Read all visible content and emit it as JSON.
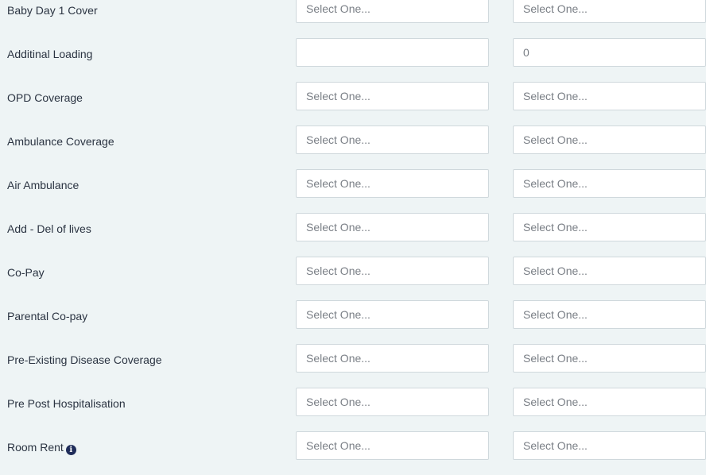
{
  "rows": [
    {
      "label": "Baby Day 1 Cover",
      "col1": "Select One...",
      "col2": "Select One..."
    },
    {
      "label": "Additinal Loading",
      "col1": "",
      "col2": "0"
    },
    {
      "label": "OPD Coverage",
      "col1": "Select One...",
      "col2": "Select One..."
    },
    {
      "label": "Ambulance Coverage",
      "col1": "Select One...",
      "col2": "Select One..."
    },
    {
      "label": "Air Ambulance",
      "col1": "Select One...",
      "col2": "Select One..."
    },
    {
      "label": "Add - Del of lives",
      "col1": "Select One...",
      "col2": "Select One..."
    },
    {
      "label": "Co-Pay",
      "col1": "Select One...",
      "col2": "Select One..."
    },
    {
      "label": "Parental Co-pay",
      "col1": "Select One...",
      "col2": "Select One..."
    },
    {
      "label": "Pre-Existing Disease Coverage",
      "col1": "Select One...",
      "col2": "Select One..."
    },
    {
      "label": "Pre Post Hospitalisation",
      "col1": "Select One...",
      "col2": "Select One..."
    },
    {
      "label": "Room Rent",
      "col1": "Select One...",
      "col2": "Select One...",
      "icon": "info-icon"
    }
  ],
  "info_icon_glyph": "i",
  "colors": {
    "background": "#eef4f5",
    "label_text": "#2b3442",
    "field_text": "#7a7f86",
    "field_border": "#cfd8dc",
    "info_icon": "#1f2d5a"
  }
}
